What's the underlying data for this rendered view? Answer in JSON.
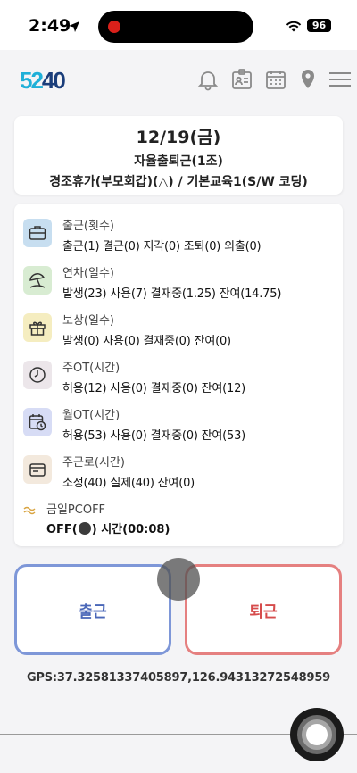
{
  "status_bar": {
    "time": "2:49",
    "battery": "96",
    "location_icon": "location-arrow-icon",
    "wifi_icon": "wifi-icon"
  },
  "header": {
    "logo_text": "5240",
    "logo_colors": [
      "#1fb0d8",
      "#1a3d7a"
    ],
    "icons": [
      "bell-icon",
      "id-card-icon",
      "calendar-icon",
      "map-pin-icon",
      "menu-icon"
    ]
  },
  "date_card": {
    "date": "12/19(금)",
    "work_type": "자율출퇴근(1조)",
    "schedule": "경조휴가(부모회갑)(△) / 기본교육1(S/W 코딩)"
  },
  "stats": [
    {
      "label": "출근(횟수)",
      "value": "출근(1) 결근(0) 지각(0) 조퇴(0) 외출(0)",
      "icon": "briefcase-icon",
      "bg": "#c7def0"
    },
    {
      "label": "연차(일수)",
      "value": "발생(23) 사용(7) 결재중(1.25) 잔여(14.75)",
      "icon": "beach-umbrella-icon",
      "bg": "#d8ecd2"
    },
    {
      "label": "보상(일수)",
      "value": "발생(0) 사용(0) 결재중(0) 잔여(0)",
      "icon": "gift-icon",
      "bg": "#f5edc0"
    },
    {
      "label": "주OT(시간)",
      "value": "허용(12) 사용(0) 결재중(0) 잔여(12)",
      "icon": "clock-icon",
      "bg": "#ece6ea"
    },
    {
      "label": "월OT(시간)",
      "value": "허용(53) 사용(0) 결재중(0) 잔여(53)",
      "icon": "calendar-clock-icon",
      "bg": "#d7dcf5"
    },
    {
      "label": "주근로(시간)",
      "value": "소정(40) 실제(40) 잔여(0)",
      "icon": "wallet-icon",
      "bg": "#f3e9dd"
    }
  ],
  "pcoff": {
    "label": "금일PCOFF",
    "value_prefix": "OFF(",
    "value_suffix": ") 시간(00:08)"
  },
  "buttons": {
    "clock_in": "출근",
    "clock_out": "퇴근"
  },
  "gps": "GPS:37.32581337405897,126.94313272548959"
}
